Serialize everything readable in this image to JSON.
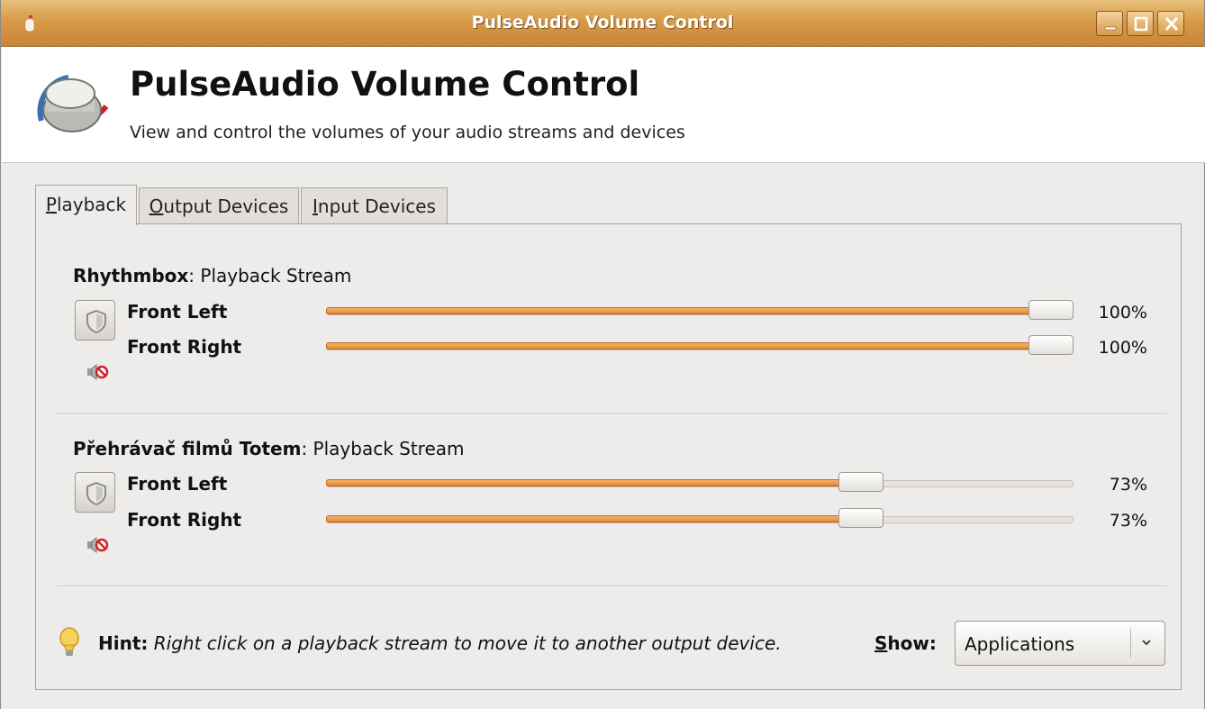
{
  "window": {
    "title": "PulseAudio Volume Control"
  },
  "header": {
    "title": "PulseAudio Volume Control",
    "subtitle": "View and control the volumes of your audio streams and devices"
  },
  "tabs": [
    {
      "mnemonic": "P",
      "rest": "layback",
      "active": true
    },
    {
      "mnemonic": "O",
      "rest": "utput Devices",
      "active": false
    },
    {
      "mnemonic": "I",
      "rest": "nput Devices",
      "active": false
    }
  ],
  "streams": [
    {
      "app": "Rhythmbox",
      "suffix": ": Playback Stream",
      "channels": [
        {
          "label": "Front Left",
          "percent": "100%",
          "level": 1.0
        },
        {
          "label": "Front Right",
          "percent": "100%",
          "level": 1.0
        }
      ]
    },
    {
      "app": "Přehrávač filmů Totem",
      "suffix": ": Playback Stream",
      "channels": [
        {
          "label": "Front Left",
          "percent": "73%",
          "level": 0.73
        },
        {
          "label": "Front Right",
          "percent": "73%",
          "level": 0.73
        }
      ]
    }
  ],
  "hint": {
    "label": "Hint:",
    "text": "Right click on a playback stream to move it to another output device."
  },
  "show": {
    "mnemonic": "S",
    "rest": "how:",
    "selected": "Applications"
  },
  "colors": {
    "accent": "#e7892e",
    "titlebar": "#d79a47"
  },
  "icons": {
    "app": "pulseaudio-knob-icon",
    "lock": "shield-lock-icon",
    "mute": "speaker-mute-icon",
    "hint": "lightbulb-icon"
  }
}
